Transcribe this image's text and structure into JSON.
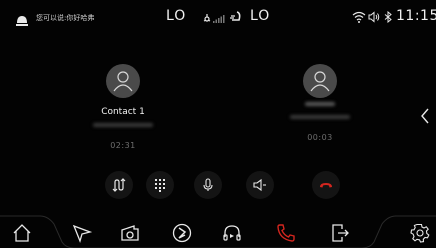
{
  "status_bar": {
    "assistant_text": "您可以说:你好哈弗",
    "temp_left": "LO",
    "temp_right": "LO",
    "clock": "11:15"
  },
  "calls": [
    {
      "contact_name": "Contact 1",
      "duration": "02:31"
    },
    {
      "contact_name": "",
      "duration": "00:03"
    }
  ],
  "call_controls": [
    "swap-calls",
    "keypad",
    "microphone",
    "speaker",
    "hang-up"
  ],
  "dock": [
    "home",
    "navigation",
    "camera",
    "music",
    "podcast",
    "phone",
    "exit",
    "settings"
  ],
  "colors": {
    "accent_red": "#d4261f",
    "background": "#030303",
    "avatar_bg": "#4a4a4a"
  }
}
